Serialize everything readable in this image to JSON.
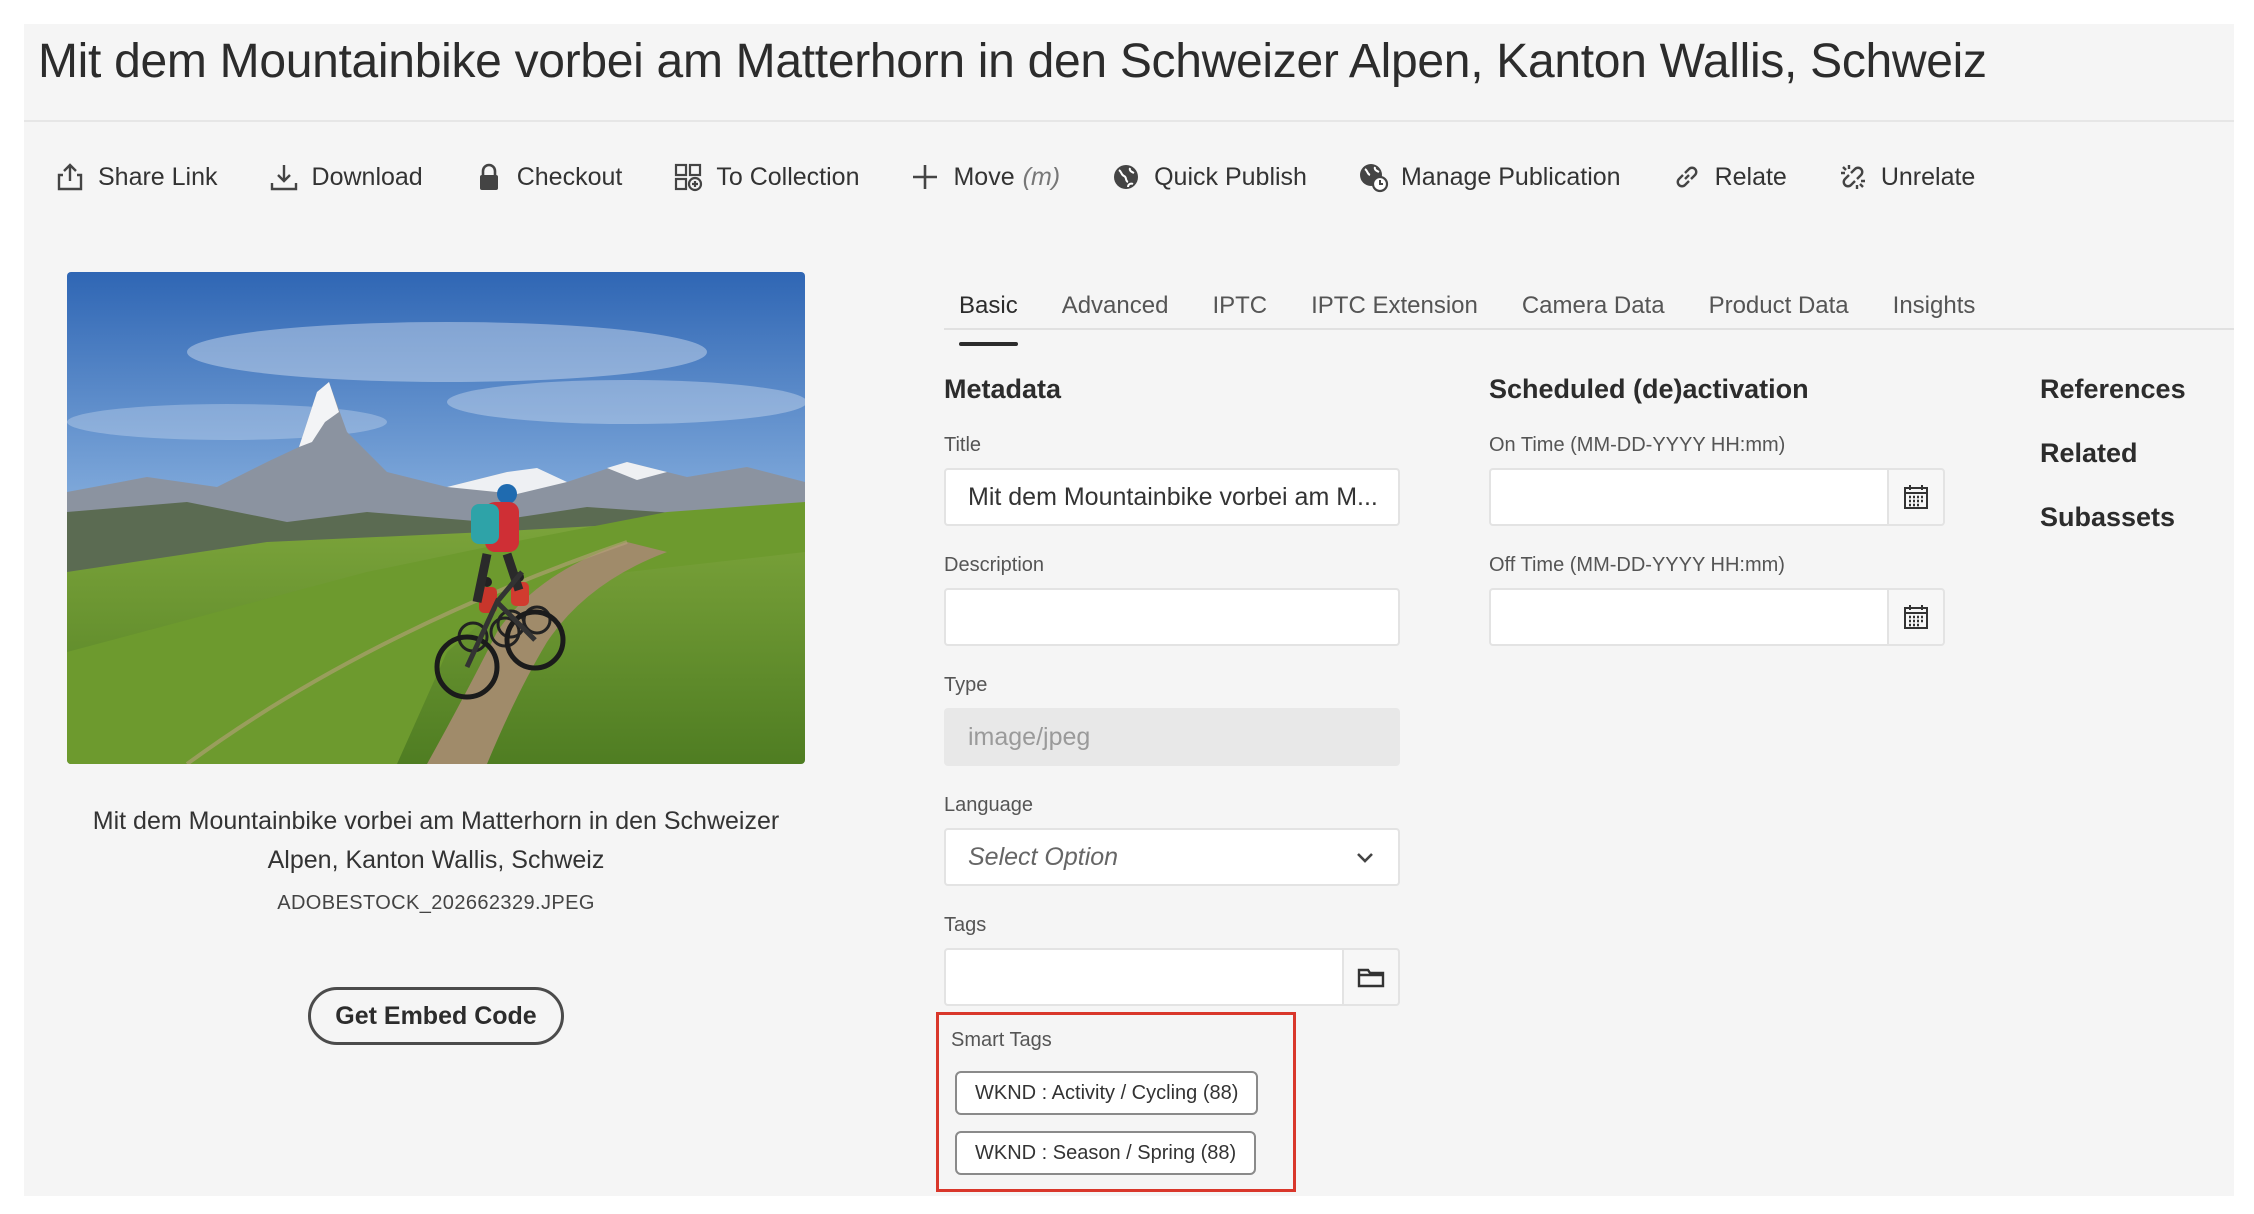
{
  "asset": {
    "title": "Mit dem Mountainbike vorbei am Matterhorn in den Schweizer Alpen, Kanton Wallis, Schweiz",
    "filename": "ADOBESTOCK_202662329.JPEG",
    "embed_label": "Get Embed Code"
  },
  "toolbar": {
    "share_link": "Share Link",
    "download": "Download",
    "checkout": "Checkout",
    "to_collection": "To Collection",
    "move": "Move",
    "move_hint": "(m)",
    "quick_publish": "Quick Publish",
    "manage_publication": "Manage Publication",
    "relate": "Relate",
    "unrelate": "Unrelate"
  },
  "tabs": [
    "Basic",
    "Advanced",
    "IPTC",
    "IPTC Extension",
    "Camera Data",
    "Product Data",
    "Insights"
  ],
  "metadata": {
    "heading": "Metadata",
    "title_label": "Title",
    "title_value": "Mit dem Mountainbike vorbei am M...",
    "description_label": "Description",
    "description_value": "",
    "type_label": "Type",
    "type_value": "image/jpeg",
    "language_label": "Language",
    "language_value": "Select Option",
    "tags_label": "Tags",
    "tags_value": ""
  },
  "schedule": {
    "heading": "Scheduled (de)activation",
    "on_label": "On Time (MM-DD-YYYY HH:mm)",
    "on_value": "",
    "off_label": "Off Time (MM-DD-YYYY HH:mm)",
    "off_value": ""
  },
  "side_links": [
    "References",
    "Related",
    "Subassets"
  ],
  "smart_tags": {
    "label": "Smart Tags",
    "items": [
      "WKND : Activity / Cycling (88)",
      "WKND : Season / Spring (88)"
    ],
    "highlight_color": "#d9372b"
  }
}
